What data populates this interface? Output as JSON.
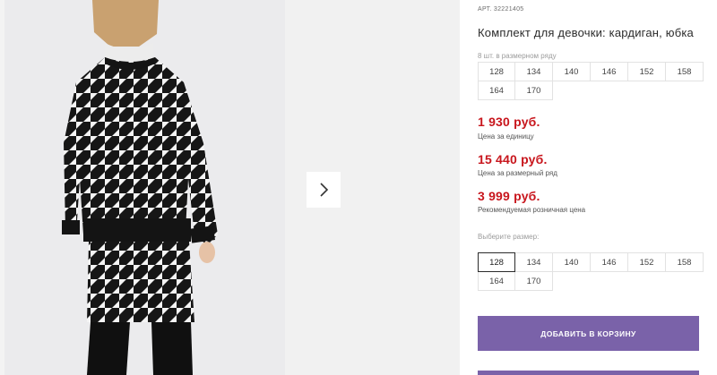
{
  "product": {
    "article_label": "АРТ.",
    "article_number": "32221405",
    "title": "Комплект для девочки: кардиган, юбка"
  },
  "assortment": {
    "caption": "8 шт. в размерном ряду",
    "sizes": [
      "128",
      "134",
      "140",
      "146",
      "152",
      "158",
      "164",
      "170"
    ]
  },
  "prices": [
    {
      "value": "1 930 руб.",
      "note": "Цена за единицу"
    },
    {
      "value": "15 440 руб.",
      "note": "Цена за размерный ряд"
    },
    {
      "value": "3 999 руб.",
      "note": "Рекомендуемая розничная цена"
    }
  ],
  "size_picker": {
    "label": "Выберите размер:",
    "selected": "128",
    "sizes": [
      "128",
      "134",
      "140",
      "146",
      "152",
      "158",
      "164",
      "170"
    ]
  },
  "cart": {
    "add_label": "ДОБАВИТЬ В КОРЗИНУ"
  },
  "gallery": {
    "next_icon": "chevron-right-icon"
  },
  "colors": {
    "price": "#c8161d",
    "accent_button": "#7a62a9"
  }
}
